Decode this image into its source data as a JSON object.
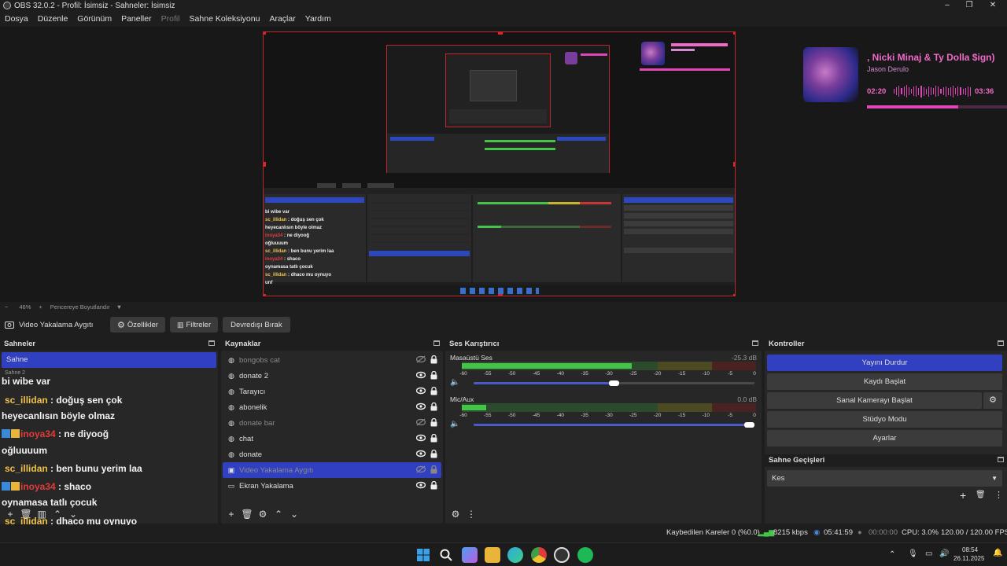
{
  "window": {
    "title": "OBS 32.0.2 - Profil: İsimsiz - Sahneler: İsimsiz",
    "minimize": "–",
    "maximize": "❐",
    "close": "✕"
  },
  "menu": [
    "Dosya",
    "Düzenle",
    "Görünüm",
    "Paneller",
    "Profil",
    "Sahne Koleksiyonu",
    "Araçlar",
    "Yardım"
  ],
  "preview": {
    "zoom": "46%",
    "zoom_mode": "Pencereye Boyutlandır",
    "spotify": {
      "title": ", Nicki Minaj & Ty Dolla $ign)",
      "artist": "Jason Derulo",
      "elapsed": "02:20",
      "total": "03:36",
      "progress": 0.65
    }
  },
  "source_toolbar": {
    "source_name": "Video Yakalama Aygıtı",
    "properties": "Özellikler",
    "filters": "Filtreler",
    "deactivate": "Devredışı Bırak"
  },
  "scenes": {
    "title": "Sahneler",
    "items": [
      "Sahne",
      "Sahne 2"
    ]
  },
  "chat": [
    {
      "user": "",
      "text": "bi wibe var"
    },
    {
      "user": "sc_illidan",
      "text": " : doğuş sen çok"
    },
    {
      "user": "",
      "text": "heyecanlısın böyle olmaz"
    },
    {
      "user": "inoya34",
      "text": " : ne diyooğ"
    },
    {
      "user": "",
      "text": "oğluuuum"
    },
    {
      "user": "sc_illidan",
      "text": " : ben bunu yerim laa"
    },
    {
      "user": "inoya34",
      "text": " : shaco"
    },
    {
      "user": "",
      "text": "oynamasa tatlı çocuk"
    },
    {
      "user": "sc_illidan",
      "text": " : dhaco mu oynuyo"
    },
    {
      "user": "",
      "text": "unf"
    },
    {
      "user": "inoya34",
      "text": " :"
    }
  ],
  "sources": {
    "title": "Kaynaklar",
    "items": [
      {
        "name": "bongobs cat",
        "visible": false,
        "icon": "browser-icon"
      },
      {
        "name": "donate 2",
        "visible": true,
        "icon": "browser-icon"
      },
      {
        "name": "Tarayıcı",
        "visible": true,
        "icon": "browser-icon"
      },
      {
        "name": "abonelik",
        "visible": true,
        "icon": "browser-icon"
      },
      {
        "name": "donate bar",
        "visible": false,
        "icon": "browser-icon"
      },
      {
        "name": "chat",
        "visible": true,
        "icon": "browser-icon"
      },
      {
        "name": "donate",
        "visible": true,
        "icon": "browser-icon"
      },
      {
        "name": "Video Yakalama Aygıtı",
        "visible": false,
        "icon": "camera-icon"
      },
      {
        "name": "Ekran Yakalama",
        "visible": true,
        "icon": "monitor-icon"
      }
    ]
  },
  "mixer": {
    "title": "Ses Karıştırıcı",
    "ticks": [
      "-60",
      "-55",
      "-50",
      "-45",
      "-40",
      "-35",
      "-30",
      "-25",
      "-20",
      "-15",
      "-10",
      "-5",
      "0"
    ],
    "channels": [
      {
        "name": "Masaüstü Ses",
        "db": "-25.3 dB",
        "level": -25.3,
        "volume": 0.5
      },
      {
        "name": "Mic/Aux",
        "db": "0.0 dB",
        "level": -55,
        "volume": 1.0
      }
    ]
  },
  "controls": {
    "title": "Kontroller",
    "stop_stream": "Yayını Durdur",
    "start_recording": "Kaydı Başlat",
    "start_virtualcam": "Sanal Kamerayı Başlat",
    "studio_mode": "Stüdyo Modu",
    "settings": "Ayarlar"
  },
  "transitions": {
    "title": "Sahne Geçişleri",
    "selected": "Kes"
  },
  "status": {
    "dropped_frames": "Kaybedilen Kareler 0 (%0.0)",
    "bitrate": "8215 kbps",
    "stream_time": "05:41:59",
    "record_time": "00:00:00",
    "cpu": "CPU: 3.0%",
    "fps": "120.00 / 120.00 FPS"
  },
  "taskbar": {
    "time": "08:54",
    "date": "26.11.2025"
  },
  "colors": {
    "accent": "#3140c1",
    "meter_green": "#45c44a",
    "meter_yellow": "#c9b52c",
    "meter_red": "#c93434",
    "selection_border": "#c0262b",
    "spotify_pink": "#f06ac8"
  }
}
